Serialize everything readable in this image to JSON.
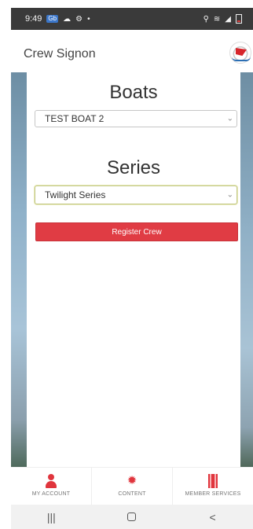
{
  "status_bar": {
    "time": "9:49",
    "badge": "Gb",
    "left_icons": [
      "cloud-icon",
      "settings-icon"
    ],
    "right_icons": [
      "location-icon",
      "wifi-icon",
      "signal-icon",
      "battery-icon"
    ]
  },
  "header": {
    "title": "Crew Signon",
    "logo": "club-logo"
  },
  "boats": {
    "title": "Boats",
    "selected": "TEST BOAT 2"
  },
  "series": {
    "title": "Series",
    "selected": "Twilight Series"
  },
  "register_button": "Register Crew",
  "bottom_nav": [
    {
      "label": "MY ACCOUNT",
      "icon": "person-icon"
    },
    {
      "label": "CONTENT",
      "icon": "gear-icon"
    },
    {
      "label": "MEMBER SERVICES",
      "icon": "building-icon"
    }
  ],
  "system_nav": {
    "recents": "|||",
    "home": "○",
    "back": "<"
  },
  "colors": {
    "accent": "#e03c44",
    "status_bar": "#3a3a3a"
  }
}
